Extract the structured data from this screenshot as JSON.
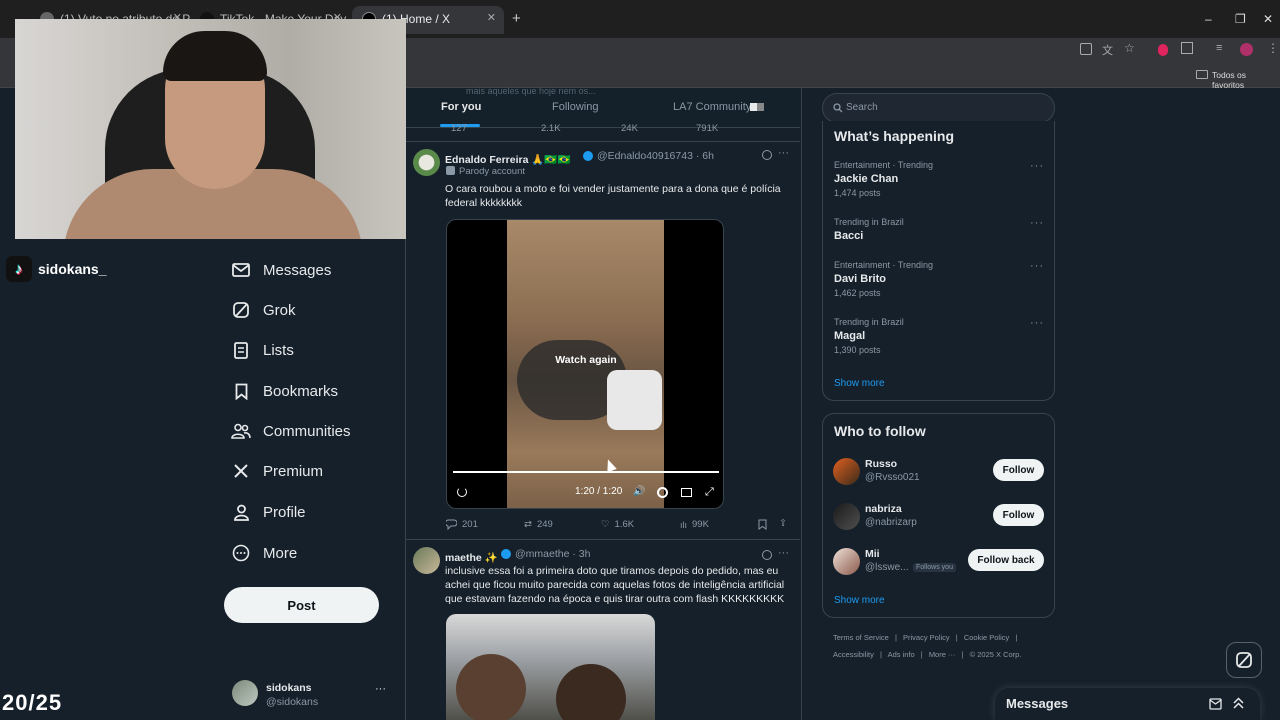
{
  "browser": {
    "tabs": [
      {
        "title": "(1) Vuto no atributo do Presa..."
      },
      {
        "title": "TikTok - Make Your Day"
      },
      {
        "title": "(1) Home / X"
      }
    ],
    "bookmarks_folder": "Todos os favoritos"
  },
  "feed": {
    "tabs": [
      "For you",
      "Following",
      "LA7 Community"
    ],
    "partial_text": "mais aqueles que hoje nem os...",
    "prev_stats": {
      "replies": "127",
      "reposts": "2.1K",
      "likes": "24K",
      "views": "791K"
    },
    "tweets": [
      {
        "name": "Ednaldo Ferreira 🙏🇧🇷🇧🇷",
        "handle": "@Ednaldo40916743 · 6h",
        "badge": "Parody account",
        "text": "O cara roubou a moto e foi vender justamente para a dona que é polícia federal kkkkkkkk",
        "video": {
          "overlay": "Watch again",
          "time": "1:20 / 1:20",
          "progress": 1.0
        },
        "stats": {
          "replies": "201",
          "reposts": "249",
          "likes": "1.6K",
          "views": "99K"
        }
      },
      {
        "name": "maethe ✨",
        "handle": "@mmaethe · 3h",
        "text": "inclusive essa foi a primeira doto que tiramos depois do pedido, mas eu achei que ficou muito parecida com aquelas fotos de inteligência artificial que estavam fazendo na época e quis tirar outra com flash KKKKKKKKK"
      }
    ]
  },
  "nav": {
    "items": [
      {
        "label": "Messages",
        "icon": "mail-icon"
      },
      {
        "label": "Grok",
        "icon": "grok-icon"
      },
      {
        "label": "Lists",
        "icon": "list-icon"
      },
      {
        "label": "Bookmarks",
        "icon": "bookmark-icon"
      },
      {
        "label": "Communities",
        "icon": "people-icon"
      },
      {
        "label": "Premium",
        "icon": "x-icon"
      },
      {
        "label": "Profile",
        "icon": "person-icon"
      },
      {
        "label": "More",
        "icon": "more-circle-icon"
      }
    ],
    "post_label": "Post",
    "account": {
      "name": "sidokans",
      "handle": "@sidokans"
    }
  },
  "right": {
    "search_placeholder": "Search",
    "happening_title": "What’s happening",
    "trends": [
      {
        "meta": "Entertainment · Trending",
        "name": "Jackie Chan",
        "posts": "1,474 posts"
      },
      {
        "meta": "Trending in Brazil",
        "name": "Bacci",
        "posts": ""
      },
      {
        "meta": "Entertainment · Trending",
        "name": "Davi Brito",
        "posts": "1,462 posts"
      },
      {
        "meta": "Trending in Brazil",
        "name": "Magal",
        "posts": "1,390 posts"
      }
    ],
    "show_more": "Show more",
    "wtf_title": "Who to follow",
    "follow": [
      {
        "name": "Russo",
        "handle": "@Rvsso021",
        "button": "Follow",
        "follows_you": ""
      },
      {
        "name": "nabriza",
        "handle": "@nabrizarp",
        "button": "Follow",
        "follows_you": ""
      },
      {
        "name": "Mii",
        "handle": "@lsswe...",
        "button": "Follow back",
        "follows_you": "Follows you"
      }
    ],
    "footer": [
      "Terms of Service",
      "Privacy Policy",
      "Cookie Policy",
      "Accessibility",
      "Ads info",
      "More ···",
      "© 2025 X Corp."
    ],
    "messages_label": "Messages"
  },
  "overlay": {
    "tiktok_user": "sidokans_",
    "counter": "20/25"
  },
  "colors": {
    "accent": "#1d9bf0",
    "bg": "#15202b",
    "border": "#38444d",
    "muted": "#8b98a5"
  }
}
